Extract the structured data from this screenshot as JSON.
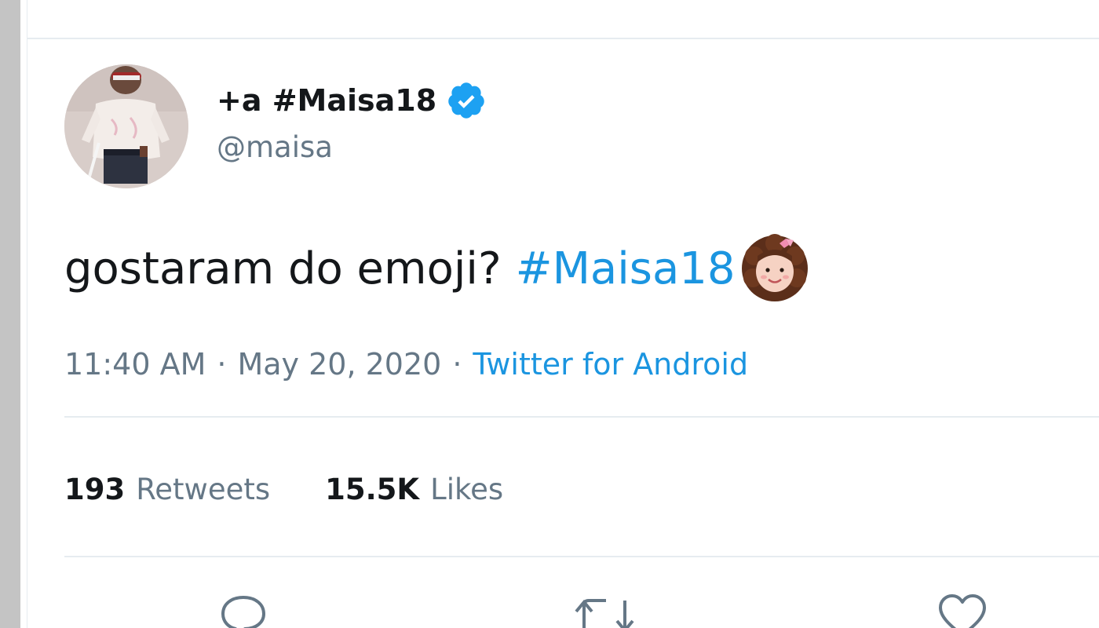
{
  "tweet": {
    "display_name": "+a #Maisa18",
    "handle": "@maisa",
    "verified": true,
    "text": "gostaram do emoji?",
    "hashtag": "#Maisa18",
    "time": "11:40 AM",
    "separator": "·",
    "date": "May 20, 2020",
    "source": "Twitter for Android",
    "retweets_count": "193",
    "retweets_label": "Retweets",
    "likes_count": "15.5K",
    "likes_label": "Likes"
  },
  "icons": {
    "verified": "verified-badge-icon",
    "reply": "reply-icon",
    "retweet": "retweet-icon",
    "like": "heart-icon"
  },
  "colors": {
    "link": "#1b95e0",
    "text": "#14171a",
    "secondary": "#657786",
    "divider": "#e6ecf0"
  }
}
